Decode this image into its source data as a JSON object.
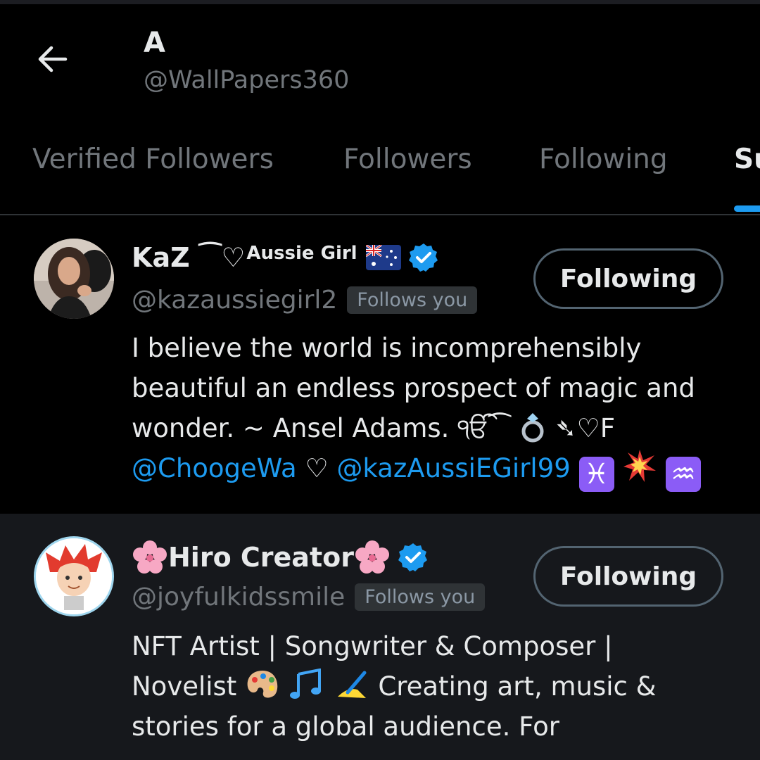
{
  "header": {
    "title": "A",
    "handle": "@WallPapers360"
  },
  "tabs": [
    {
      "label": "Verified Followers",
      "active": false
    },
    {
      "label": "Followers",
      "active": false
    },
    {
      "label": "Following",
      "active": false
    },
    {
      "label": "Su",
      "active": true
    }
  ],
  "colors": {
    "accent": "#1d9bf0",
    "background": "#000000",
    "muted_text": "#71767b"
  },
  "users": [
    {
      "name": "KaZ ⁀♡",
      "name_suffix": "Aussie Girl",
      "flag_icon": "australia-flag-icon",
      "verified": true,
      "handle": "@kazaussiegirl2",
      "follows_you": "Follows you",
      "button": "Following",
      "bio_line1": "I believe the world is incomprehensibly",
      "bio_line2": "beautiful an endless prospect of magic and",
      "bio_line3": "wonder. ~ Ansel Adams. ੴ⁀",
      "bio_line3_end": "➴♡F",
      "mention1": "@ChoogeWa",
      "heart": "♡",
      "mention2": "@kazAussiEGirl99",
      "end_icons": [
        "pisces-icon",
        "collision-icon",
        "aquarius-icon"
      ]
    },
    {
      "name": "Hiro Creator",
      "verified": true,
      "handle": "@joyfulkidssmile",
      "follows_you": "Follows you",
      "button": "Following",
      "bio_line1": "NFT Artist | Songwriter & Composer |",
      "bio_line2a": "Novelist",
      "bio_line2b": "Creating art, music &",
      "bio_line3": "stories for a global audience. For"
    }
  ]
}
